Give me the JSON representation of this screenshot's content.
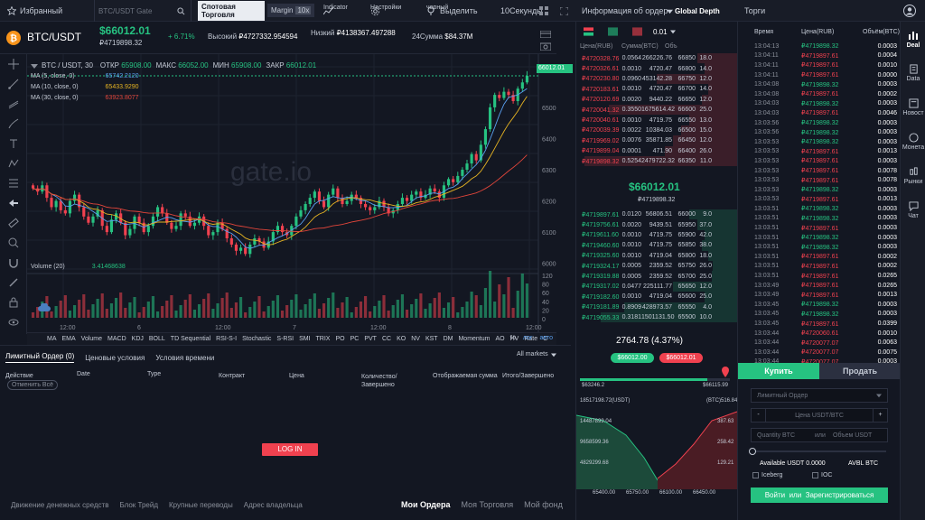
{
  "topbar": {
    "favorites": "Избранный",
    "search_placeholder": "BTC/USDT Gate",
    "spot_label": "Спотовая Торговля",
    "margin_label": "Margin",
    "margin_mult": "10x",
    "indicator": "Indicator",
    "settings": "Настройки",
    "theme": "черный",
    "select": "Выделить",
    "interval": "10Секунды",
    "info": "Информация об ордер",
    "depth": "Global Depth",
    "trades": "Торги"
  },
  "ticker": {
    "pair_base": "BTC",
    "pair_quote": "/USDT",
    "price": "$66012.01",
    "price_rub": "₽4719898.32",
    "change": "+ 6.71%",
    "high_label": "Высокий",
    "high": "₽4727332.954594",
    "low_label": "Низкий",
    "low": "₽4138367.497288",
    "vol_label": "24Сумма",
    "vol": "$84.37M"
  },
  "chart_legend": {
    "pair": "BTC / USDT, 30",
    "open_label": "ОТКР",
    "open": "65908.00",
    "max_label": "МАКС",
    "max": "66052.00",
    "min_label": "МИН",
    "min": "65908.00",
    "close_label": "ЗАКР",
    "close": "66012.01",
    "ma5": "MA (5, close, 0)",
    "ma5v": "65742.2120",
    "ma10": "MA (10, close, 0)",
    "ma10v": "65433.9290",
    "ma30": "MA (30, close, 0)",
    "ma30v": "63923.8077",
    "vol_label": "Volume (20)",
    "vol_v": "3.41468638",
    "last": "66012.01",
    "watermark": "gate.io"
  },
  "chart_data": {
    "type": "candlestick",
    "y_ticks": [
      "65000.00",
      "64000.00",
      "63000.00",
      "62000.00",
      "61000.00",
      "60000.00"
    ],
    "vol_ticks": [
      "120",
      "80",
      "60",
      "40",
      "20",
      "0"
    ],
    "x_ticks": [
      "12:00",
      "6",
      "12:00",
      "7",
      "12:00",
      "8",
      "12:00"
    ],
    "ylim": [
      59700,
      66300
    ],
    "closes": [
      62400,
      62300,
      62500,
      62100,
      61800,
      62000,
      61700,
      61600,
      62000,
      62200,
      61800,
      61500,
      61300,
      61500,
      61700,
      61200,
      61000,
      61400,
      61600,
      61300,
      60900,
      61100,
      61500,
      61300,
      61000,
      61200,
      61500,
      61800,
      61600,
      61300,
      61100,
      61200,
      61600,
      61500,
      61200,
      61300,
      61500,
      61200,
      60900,
      61000,
      61300,
      61100,
      60800,
      60600,
      60400,
      60500,
      60300,
      60600,
      60800,
      60700,
      60500,
      60700,
      61000,
      61200,
      61000,
      60900,
      61200,
      61500,
      61700,
      61900,
      62100,
      62300,
      62000,
      61800,
      62200,
      62400,
      62100,
      61900,
      62000,
      62200,
      62100,
      61900,
      61800,
      61700,
      61800,
      62000,
      61800,
      61600,
      61700,
      61900,
      62100,
      62000,
      62200,
      62300,
      62100,
      62200,
      62400,
      62300,
      62100,
      62500,
      62700,
      62600,
      62800,
      63000,
      63200,
      63500,
      63300,
      63800,
      64300,
      65000,
      65400,
      65300,
      65500,
      65400,
      65200,
      65600,
      65800,
      66012
    ]
  },
  "indicators": [
    "MA",
    "EMA",
    "Volume",
    "MACD",
    "KDJ",
    "BOLL",
    "TD Sequential",
    "RSI-S-I",
    "Stochastic",
    "S-RSI",
    "SMI",
    "TRIX",
    "PO",
    "PC",
    "PVT",
    "CC",
    "KO",
    "NV",
    "KST",
    "DM",
    "Momentum",
    "AO",
    "HV",
    "Rate",
    "C"
  ],
  "ind_right": [
    "%",
    "лог",
    "авто"
  ],
  "orders": {
    "tabs": [
      "Лимитный Ордер (0)",
      "Ценовые условия",
      "Условия времени"
    ],
    "markets": "All markets",
    "cols": [
      "Действие",
      "Date",
      "Type",
      "Контракт",
      "Цена",
      "Количество/ Завершено",
      "Отображаемая сумма",
      "Итого/Завершено"
    ],
    "cancel_all": "Отменить Всё",
    "login": "LOG IN",
    "bottom_left": [
      "Движение денежных средств",
      "Блок Трейд",
      "Крупные переводы",
      "Адрес владельца"
    ],
    "bottom_right": [
      "Мои Ордера",
      "Моя Торговля",
      "Мой фонд"
    ]
  },
  "book": {
    "precision": "0.01",
    "headers": [
      "Цена(RUB)",
      "Сумма(BTC)",
      "Объ"
    ],
    "asks": [
      [
        "₽4720328.76",
        "0.0564",
        "266226.76",
        "66850",
        "18.0",
        0.25
      ],
      [
        "₽4720326.61",
        "0.0010",
        "4720.47",
        "66800",
        "14.0",
        0.2
      ],
      [
        "₽4720230.80",
        "0.0960",
        "453142.28",
        "66750",
        "12.0",
        0.5
      ],
      [
        "₽4720183.61",
        "0.0010",
        "4720.47",
        "66700",
        "14.0",
        0.18
      ],
      [
        "₽4720120.69",
        "0.0020",
        "9440.22",
        "66650",
        "12.0",
        0.22
      ],
      [
        "₽4720041.32",
        "0.3550",
        "1675614.42",
        "66600",
        "25.0",
        0.8
      ],
      [
        "₽4720040.61",
        "0.0010",
        "4719.75",
        "66550",
        "13.0",
        0.3
      ],
      [
        "₽4720039.39",
        "0.0022",
        "10384.03",
        "66500",
        "15.0",
        0.35
      ],
      [
        "₽4719969.02",
        "0.0076",
        "35871.85",
        "66450",
        "12.0",
        0.4
      ],
      [
        "₽4719899.04",
        "0.0001",
        "471.90",
        "66400",
        "26.0",
        0.45
      ],
      [
        "₽4719898.32",
        "0.5254",
        "2479722.32",
        "66350",
        "11.0",
        0.95
      ]
    ],
    "mid_price": "$66012.01",
    "mid_rub": "₽4719898.32",
    "bids": [
      [
        "₽4719897.61",
        "0.0120",
        "56806.51",
        "66000",
        "9.0",
        0.3
      ],
      [
        "₽4719756.61",
        "0.0020",
        "9439.51",
        "65950",
        "37.0",
        0.25
      ],
      [
        "₽4719611.60",
        "0.0010",
        "4719.75",
        "65900",
        "42.0",
        0.2
      ],
      [
        "₽4719460.60",
        "0.0010",
        "4719.75",
        "65850",
        "38.0",
        0.22
      ],
      [
        "₽4719325.60",
        "0.0010",
        "4719.04",
        "65800",
        "18.0",
        0.18
      ],
      [
        "₽4719324.17",
        "0.0005",
        "2359.52",
        "65750",
        "26.0",
        0.15
      ],
      [
        "₽4719319.88",
        "0.0005",
        "2359.52",
        "65700",
        "25.0",
        0.16
      ],
      [
        "₽4719317.02",
        "0.0477",
        "225111.77",
        "65650",
        "12.0",
        0.4
      ],
      [
        "₽4719182.60",
        "0.0010",
        "4719.04",
        "65600",
        "25.0",
        0.2
      ],
      [
        "₽4719181.89",
        "0.8909",
        "428973.57",
        "65550",
        "4.0",
        0.7
      ],
      [
        "₽4719055.33",
        "0.3181",
        "1501131.50",
        "65500",
        "10.0",
        0.85
      ]
    ],
    "spread": "2764.78",
    "spread_pct": "(4.37%)",
    "btn_green": "$66012.00",
    "btn_red": "$66012.01",
    "bar_left": "$63246.2",
    "bar_right": "$66115.99",
    "depth_left": "18517198.72(USDT)",
    "depth_right": "(BTC)516.84",
    "depth_y": [
      "14487899.04",
      "9658599.36",
      "4829299.68"
    ],
    "depth_yr": [
      "387.63",
      "258.42",
      "129.21"
    ],
    "depth_x": [
      "65400.00",
      "65750.00",
      "66100.00",
      "66450.00"
    ]
  },
  "trades": {
    "headers": [
      "Время",
      "Цена(RUB)",
      "Объём(BTC)"
    ],
    "rows": [
      [
        "13:04:13",
        "₽4719898.32",
        "0.0003",
        "g"
      ],
      [
        "13:04:11",
        "₽4719897.61",
        "0.0004",
        "r"
      ],
      [
        "13:04:11",
        "₽4719897.61",
        "0.0010",
        "r"
      ],
      [
        "13:04:11",
        "₽4719897.61",
        "0.0000",
        "r"
      ],
      [
        "13:04:08",
        "₽4719898.32",
        "0.0003",
        "g"
      ],
      [
        "13:04:08",
        "₽4719897.61",
        "0.0002",
        "r"
      ],
      [
        "13:04:03",
        "₽4719898.32",
        "0.0003",
        "g"
      ],
      [
        "13:04:03",
        "₽4719897.61",
        "0.0046",
        "r"
      ],
      [
        "13:03:56",
        "₽4719898.32",
        "0.0003",
        "g"
      ],
      [
        "13:03:56",
        "₽4719898.32",
        "0.0003",
        "g"
      ],
      [
        "13:03:53",
        "₽4719898.32",
        "0.0003",
        "g"
      ],
      [
        "13:03:53",
        "₽4719897.61",
        "0.0013",
        "r"
      ],
      [
        "13:03:53",
        "₽4719897.61",
        "0.0003",
        "r"
      ],
      [
        "13:03:53",
        "₽4719897.61",
        "0.0078",
        "r"
      ],
      [
        "13:03:53",
        "₽4719897.61",
        "0.0078",
        "r"
      ],
      [
        "13:03:53",
        "₽4719898.32",
        "0.0003",
        "g"
      ],
      [
        "13:03:53",
        "₽4719897.61",
        "0.0013",
        "r"
      ],
      [
        "13:03:51",
        "₽4719898.32",
        "0.0003",
        "g"
      ],
      [
        "13:03:51",
        "₽4719898.32",
        "0.0003",
        "g"
      ],
      [
        "13:03:51",
        "₽4719897.61",
        "0.0003",
        "r"
      ],
      [
        "13:03:51",
        "₽4719898.32",
        "0.0003",
        "g"
      ],
      [
        "13:03:51",
        "₽4719898.32",
        "0.0003",
        "g"
      ],
      [
        "13:03:51",
        "₽4719897.61",
        "0.0002",
        "r"
      ],
      [
        "13:03:51",
        "₽4719897.61",
        "0.0002",
        "r"
      ],
      [
        "13:03:51",
        "₽4719897.61",
        "0.0265",
        "r"
      ],
      [
        "13:03:49",
        "₽4719897.61",
        "0.0265",
        "r"
      ],
      [
        "13:03:49",
        "₽4719897.61",
        "0.0013",
        "r"
      ],
      [
        "13:03:45",
        "₽4719898.32",
        "0.0003",
        "g"
      ],
      [
        "13:03:45",
        "₽4719898.32",
        "0.0003",
        "g"
      ],
      [
        "13:03:45",
        "₽4719897.61",
        "0.0399",
        "r"
      ],
      [
        "13:03:44",
        "₽4720060.61",
        "0.0010",
        "r"
      ],
      [
        "13:03:44",
        "₽4720077.07",
        "0.0063",
        "r"
      ],
      [
        "13:03:44",
        "₽4720077.07",
        "0.0075",
        "r"
      ],
      [
        "13:03:44",
        "₽4720077.07",
        "0.0003",
        "r"
      ]
    ]
  },
  "form": {
    "buy": "Купить",
    "sell": "Продать",
    "order_type": "Лимитный Ордер",
    "price_ph": "Цена USDT/BTC",
    "qty_ph": "Quantity BTC",
    "or": "или",
    "vol_ph": "Объем USDT",
    "avail_label": "Available USDT",
    "avail": "0.0000",
    "avbl": "AVBL BTC",
    "iceberg": "Iceberg",
    "ioc": "IOC",
    "login": "Войти",
    "or2": "или",
    "register": "Зарегистрироваться"
  },
  "rnav": [
    "Deal",
    "Data",
    "Новост",
    "Монета",
    "Рынки",
    "Чат"
  ],
  "colors": {
    "green": "#26c281",
    "red": "#f0414f",
    "accent": "#f5a623"
  }
}
